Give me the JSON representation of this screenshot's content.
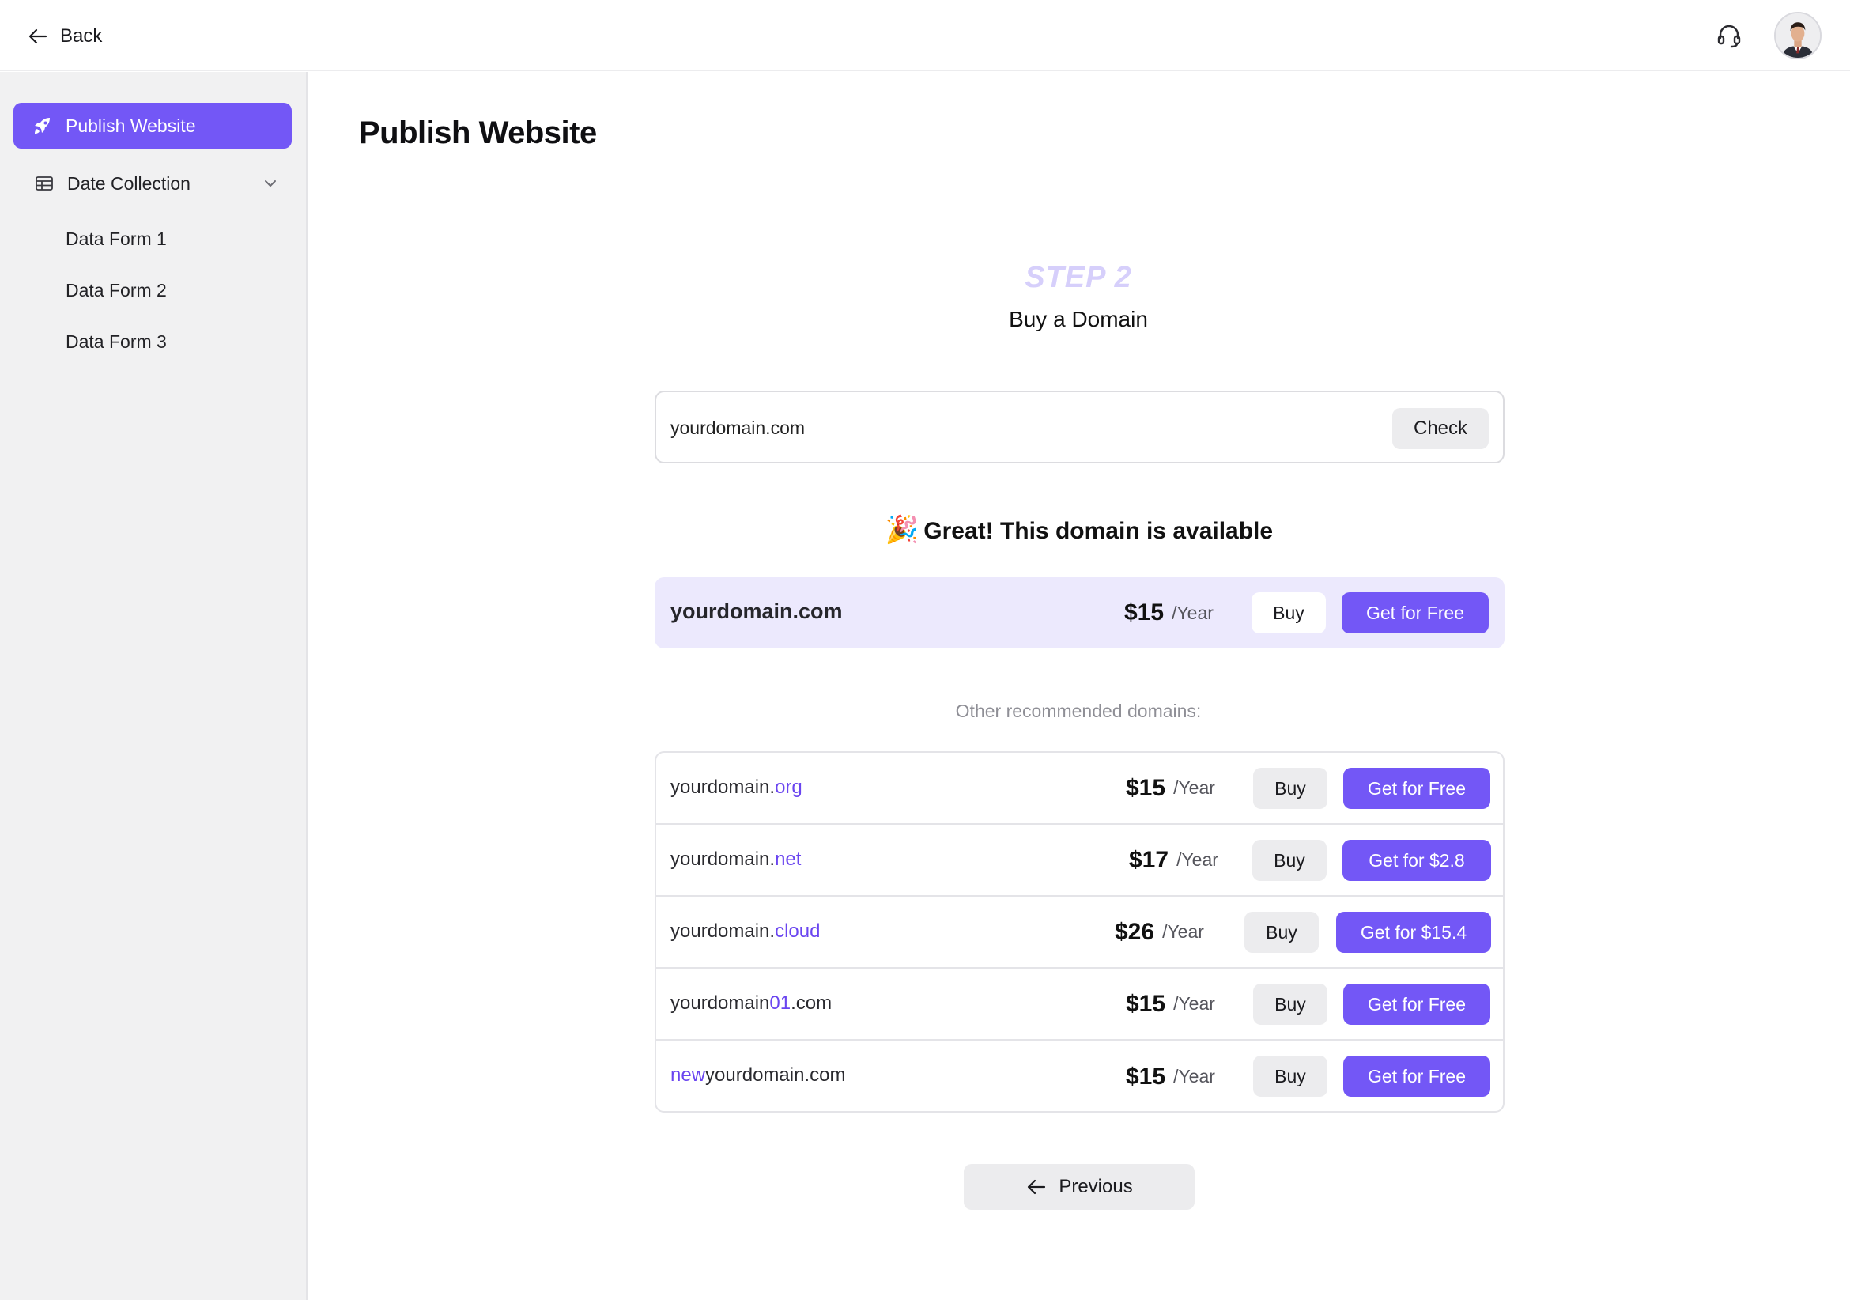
{
  "header": {
    "back_label": "Back",
    "support_icon": "headset-icon",
    "avatar_icon": "user-avatar"
  },
  "sidebar": {
    "active_item": {
      "label": "Publish Website",
      "icon": "rocket-icon"
    },
    "group": {
      "label": "Date Collection",
      "icon": "table-icon",
      "expanded": true
    },
    "sub_items": [
      {
        "label": "Data Form 1"
      },
      {
        "label": "Data Form 2"
      },
      {
        "label": "Data Form 3"
      }
    ]
  },
  "main": {
    "page_title": "Publish Website",
    "step_label": "STEP 2",
    "step_title": "Buy a Domain",
    "search": {
      "value": "yourdomain.com",
      "check_label": "Check"
    },
    "availability": {
      "emoji": "🎉",
      "message": "Great! This domain is available"
    },
    "featured": {
      "domain": "yourdomain.com",
      "price": "$15",
      "period": "/Year",
      "buy_label": "Buy",
      "cta_label": "Get  for Free"
    },
    "other_label": "Other recommended domains:",
    "recommended": [
      {
        "prefix": "",
        "highlight_pre": "",
        "base": "yourdomain.",
        "highlight": "org",
        "suffix": "",
        "price": "$15",
        "period": "/Year",
        "buy_label": "Buy",
        "cta_label": "Get  for Free"
      },
      {
        "prefix": "",
        "highlight_pre": "",
        "base": "yourdomain.",
        "highlight": "net",
        "suffix": "",
        "price": "$17",
        "period": "/Year",
        "buy_label": "Buy",
        "cta_label": "Get  for $2.8"
      },
      {
        "prefix": "",
        "highlight_pre": "",
        "base": "yourdomain.",
        "highlight": "cloud",
        "suffix": "",
        "price": "$26",
        "period": "/Year",
        "buy_label": "Buy",
        "cta_label": "Get  for $15.4"
      },
      {
        "prefix": "",
        "highlight_pre": "",
        "base": "yourdomain",
        "highlight": "01",
        "suffix": ".com",
        "price": "$15",
        "period": "/Year",
        "buy_label": "Buy",
        "cta_label": "Get for Free"
      },
      {
        "prefix": "",
        "highlight_pre": "new",
        "base": "yourdomain.com",
        "highlight": "",
        "suffix": "",
        "price": "$15",
        "period": "/Year",
        "buy_label": "Buy",
        "cta_label": "Get for Free"
      }
    ],
    "previous_label": "Previous"
  },
  "colors": {
    "accent": "#7357f6",
    "accent_light": "#ece9fd",
    "step_tint": "#d6cffb",
    "highlight_text": "#6a45f0",
    "sidebar_bg": "#f1f1f2",
    "neutral_button": "#ececee"
  }
}
